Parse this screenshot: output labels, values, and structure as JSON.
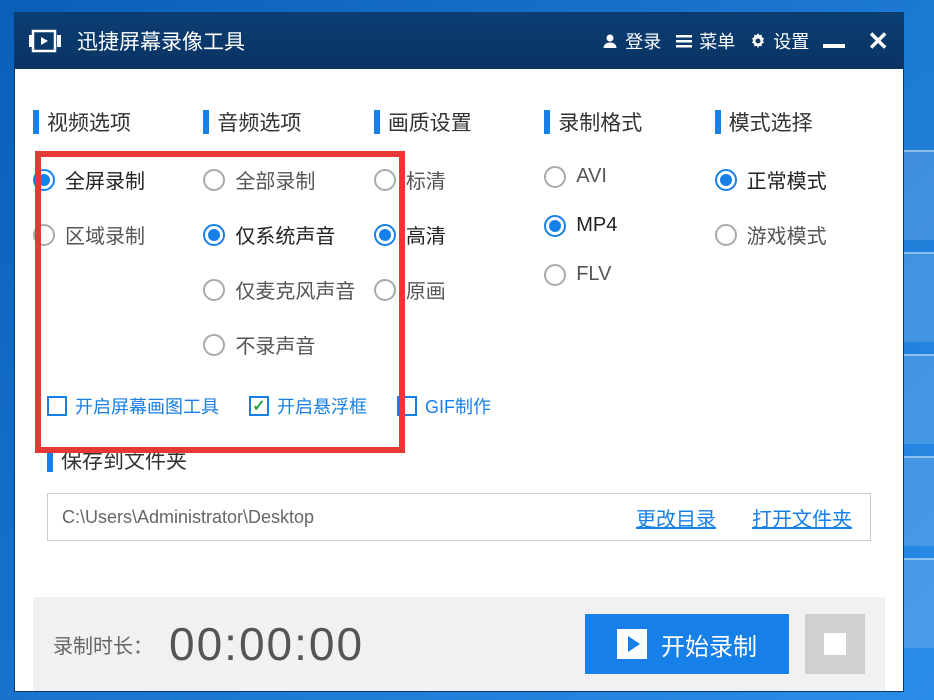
{
  "titlebar": {
    "title": "迅捷屏幕录像工具",
    "login": "登录",
    "menu": "菜单",
    "settings": "设置"
  },
  "columns": {
    "video": {
      "header": "视频选项",
      "options": [
        "全屏录制",
        "区域录制"
      ],
      "selected": 0
    },
    "audio": {
      "header": "音频选项",
      "options": [
        "全部录制",
        "仅系统声音",
        "仅麦克风声音",
        "不录声音"
      ],
      "selected": 1
    },
    "quality": {
      "header": "画质设置",
      "options": [
        "标清",
        "高清",
        "原画"
      ],
      "selected": 1
    },
    "format": {
      "header": "录制格式",
      "options": [
        "AVI",
        "MP4",
        "FLV"
      ],
      "selected": 1
    },
    "mode": {
      "header": "模式选择",
      "options": [
        "正常模式",
        "游戏模式"
      ],
      "selected": 0
    }
  },
  "checks": {
    "drawTool": {
      "label": "开启屏幕画图工具",
      "checked": false
    },
    "floatBox": {
      "label": "开启悬浮框",
      "checked": true
    },
    "gif": {
      "label": "GIF制作",
      "checked": false
    }
  },
  "save": {
    "header": "保存到文件夹",
    "path": "C:\\Users\\Administrator\\Desktop",
    "changeDir": "更改目录",
    "openFolder": "打开文件夹"
  },
  "footer": {
    "label": "录制时长：",
    "time": "00:00:00",
    "start": "开始录制"
  }
}
